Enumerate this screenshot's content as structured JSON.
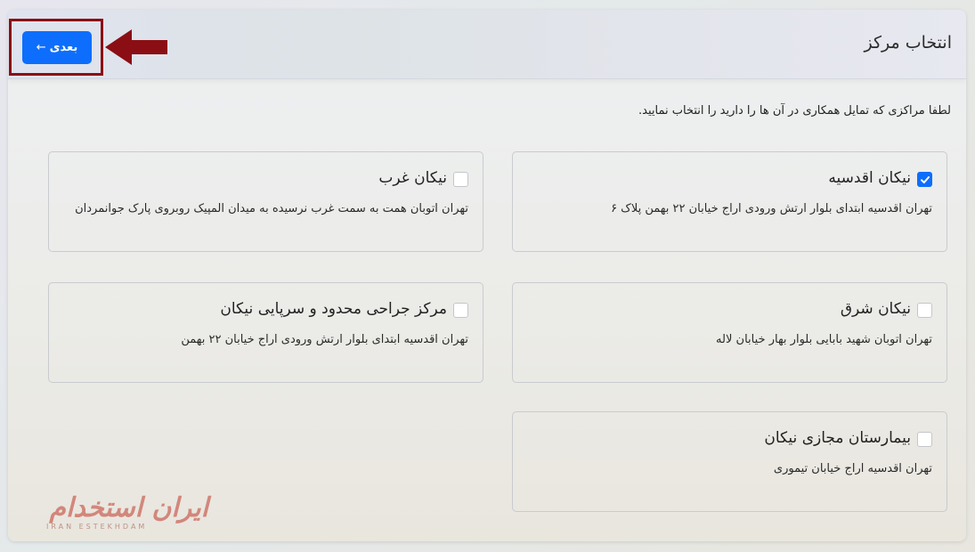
{
  "header": {
    "title": "انتخاب مرکز",
    "next_button": {
      "label": "بعدی",
      "arrow": "←"
    }
  },
  "intro_text": "لطفا مراکزی که تمایل همکاری در آن ها را دارید را انتخاب نمایید.",
  "centers": [
    {
      "name": "نیکان اقدسیه",
      "address": "تهران اقدسیه ابتدای بلوار ارتش ورودی اراج خیابان ۲۲ بهمن پلاک ۶",
      "checked": true
    },
    {
      "name": "نیکان غرب",
      "address": "تهران اتوبان همت به سمت غرب نرسیده به میدان المپیک روبروی پارک جوانمردان",
      "checked": false
    },
    {
      "name": "نیکان شرق",
      "address": "تهران اتوبان شهید بابایی بلوار بهار خیابان لاله",
      "checked": false
    },
    {
      "name": "مرکز جراحی محدود و سرپایی نیکان",
      "address": "تهران اقدسیه ابتدای بلوار ارتش ورودی اراج خیابان ۲۲ بهمن",
      "checked": false
    },
    {
      "name": "بیمارستان مجازی نیکان",
      "address": "تهران اقدسیه اراج خیابان تیموری",
      "checked": false
    }
  ],
  "watermark": {
    "main": "ایران استخدام",
    "sub": "IRAN ESTEKHDAM"
  },
  "colors": {
    "accent": "#0d6efd",
    "highlight": "#8b0e14"
  }
}
